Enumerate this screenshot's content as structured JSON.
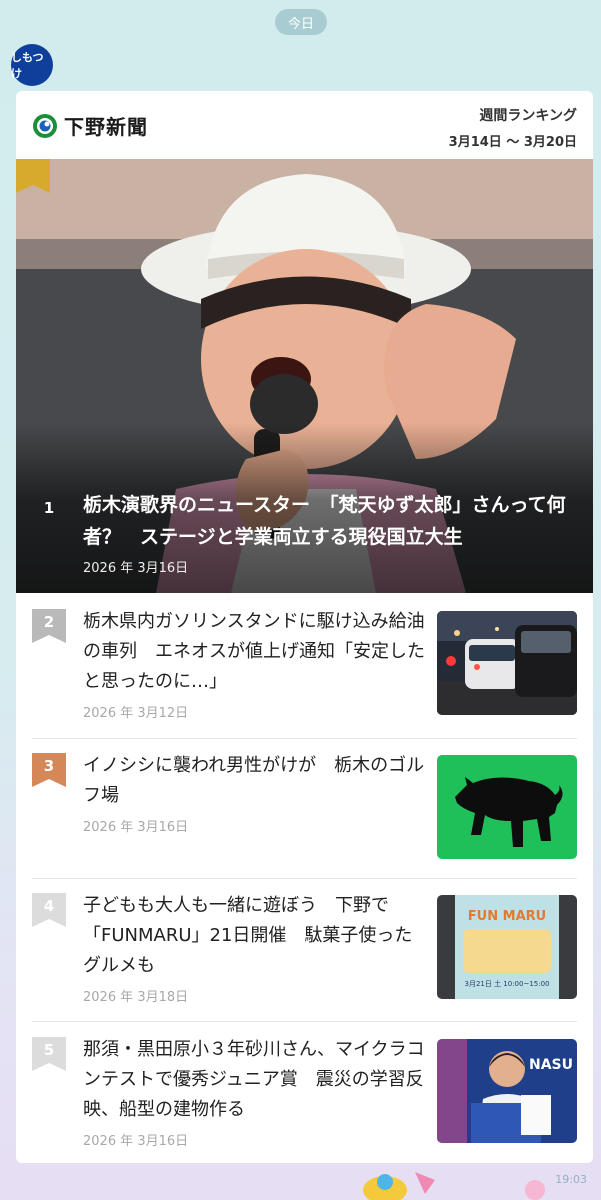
{
  "chat": {
    "date_label": "今日",
    "time": "19:03"
  },
  "sender": {
    "avatar_text": "しもつけ"
  },
  "header": {
    "brand": "下野新聞",
    "ranking_title": "週間ランキング",
    "ranking_period": "3月14日 〜 3月20日"
  },
  "featured": {
    "rank": "1",
    "title": "栃木演歌界のニュースター　「梵天ゆず太郎」さんって何者？　ステージと学業両立する現役国立大生",
    "date": "2026 年 3月16日"
  },
  "items": [
    {
      "rank": "2",
      "title": "栃木県内ガソリンスタンドに駆け込み給油の車列　エネオスが値上げ通知「安定したと思ったのに…」",
      "date": "2026 年 3月12日"
    },
    {
      "rank": "3",
      "title": "イノシシに襲われ男性がけが　栃木のゴルフ場",
      "date": "2026 年 3月16日"
    },
    {
      "rank": "4",
      "title": "子どもも大人も一緒に遊ぼう　下野で「FUNMARU」21日開催　駄菓子使ったグルメも",
      "date": "2026 年 3月18日"
    },
    {
      "rank": "5",
      "title": "那須・黒田原小３年砂川さん、マイクラコンテストで優秀ジュニア賞　震災の学習反映、船型の建物作る",
      "date": "2026 年 3月16日"
    }
  ],
  "thumbnails": {
    "poster_heading": "FUN MARU",
    "poster_date": "3月21日 土 10:00~15:00",
    "nasu_sign": "NASU"
  },
  "colors": {
    "gold": "#d7aa2d",
    "silver": "#b9b9b9",
    "bronze": "#d58758",
    "gray": "#d9d9d9",
    "brand_blue": "#0e3f9b",
    "boar_green": "#1fbf5a"
  },
  "icons": [
    "logo-mark-icon",
    "rank-badge-icon",
    "boar-icon"
  ]
}
